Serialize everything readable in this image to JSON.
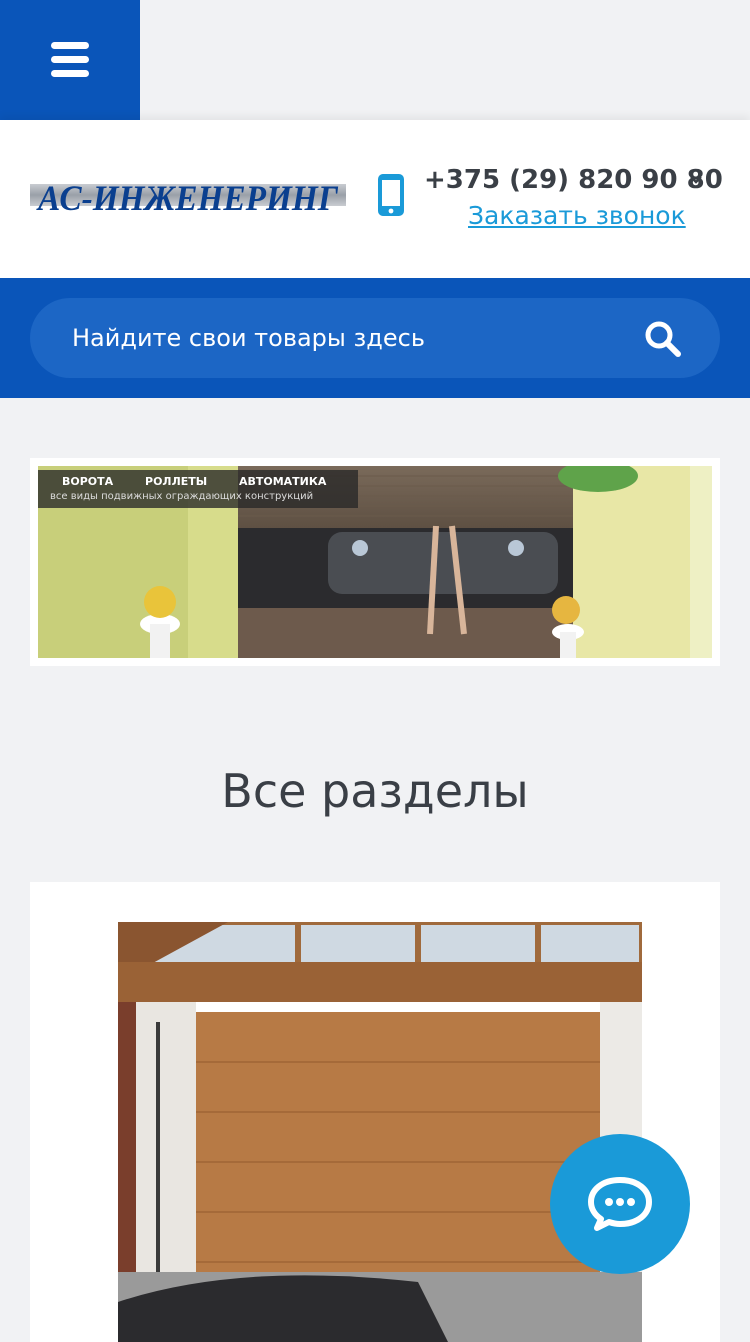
{
  "header": {
    "logo_text": "АС-ИНЖЕНЕРИНГ",
    "phone": "+375 (29) 820 90 80",
    "callback": "Заказать звонок"
  },
  "search": {
    "placeholder": "Найдите свои товары здесь"
  },
  "banner": {
    "nav": [
      "ВОРОТА",
      "РОЛЛЕТЫ",
      "АВТОМАТИКА"
    ],
    "tagline": "все виды подвижных ограждающих конструкций"
  },
  "sections": {
    "title": "Все разделы"
  },
  "colors": {
    "brand_blue": "#0a55b9",
    "accent_cyan": "#1a9ad8",
    "text_dark": "#3a3f46",
    "page_bg": "#f1f2f4"
  },
  "icons": {
    "menu": "hamburger-menu-icon",
    "phone": "smartphone-icon",
    "dropdown": "chevron-down-icon",
    "search": "search-icon",
    "chat": "chat-bubble-icon"
  }
}
